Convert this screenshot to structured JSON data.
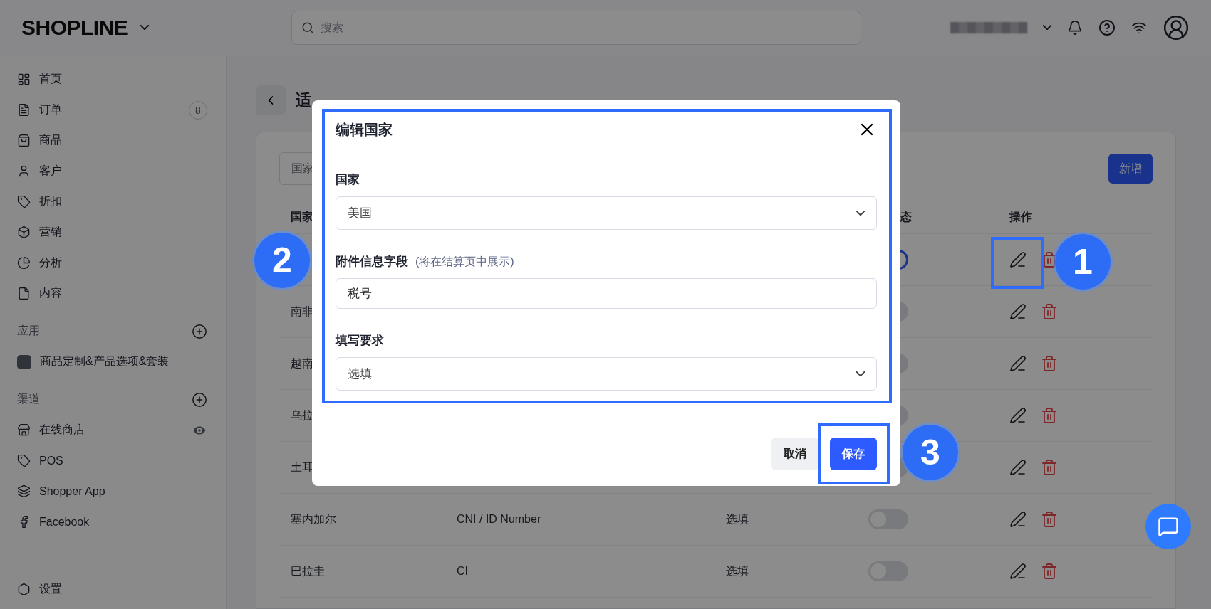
{
  "top_bar": {
    "logo": "SHOPLINE",
    "search": {
      "placeholder": "搜索"
    }
  },
  "sidebar": {
    "items": [
      {
        "label": "首页"
      },
      {
        "label": "订单",
        "badge": "8"
      },
      {
        "label": "商品"
      },
      {
        "label": "客户"
      },
      {
        "label": "折扣"
      },
      {
        "label": "营销"
      },
      {
        "label": "分析"
      },
      {
        "label": "内容"
      }
    ],
    "sections": [
      {
        "title": "应用",
        "items": [
          {
            "label": "商品定制&产品选项&套装"
          }
        ]
      },
      {
        "title": "渠道",
        "items": [
          {
            "label": "在线商店"
          },
          {
            "label": "POS"
          },
          {
            "label": "Shopper App"
          },
          {
            "label": "Facebook"
          }
        ]
      }
    ],
    "footer_item": {
      "label": "设置"
    }
  },
  "page": {
    "title": "适"
  },
  "filter": {
    "placeholder": "国家"
  },
  "add_button": "新增",
  "table": {
    "columns": [
      "国家",
      "",
      "",
      "态",
      "操作"
    ],
    "rows": [
      {
        "enabled": true
      },
      {
        "country": "南非",
        "enabled": false
      },
      {
        "country": "越南",
        "enabled": false
      },
      {
        "country": "乌拉",
        "enabled": false
      },
      {
        "country": "土耳",
        "enabled": false
      },
      {
        "country": "塞内加尔",
        "field": "CNI / ID Number",
        "requirement": "选填",
        "enabled": false
      },
      {
        "country": "巴拉圭",
        "field": "CI",
        "requirement": "选填",
        "enabled": false
      }
    ]
  },
  "modal": {
    "title": "编辑国家",
    "fields": [
      {
        "kind": "select",
        "label": "国家",
        "value": "美国"
      },
      {
        "kind": "input",
        "label": "附件信息字段",
        "hint": "(将在结算页中展示)",
        "value": "税号"
      },
      {
        "kind": "select",
        "label": "填写要求",
        "value": "选填"
      }
    ],
    "buttons": [
      {
        "label": "取消",
        "kind": "secondary"
      },
      {
        "label": "保存",
        "kind": "primary"
      }
    ]
  },
  "annotations": [
    {
      "label": "1"
    },
    {
      "label": "2"
    },
    {
      "label": "3"
    }
  ]
}
